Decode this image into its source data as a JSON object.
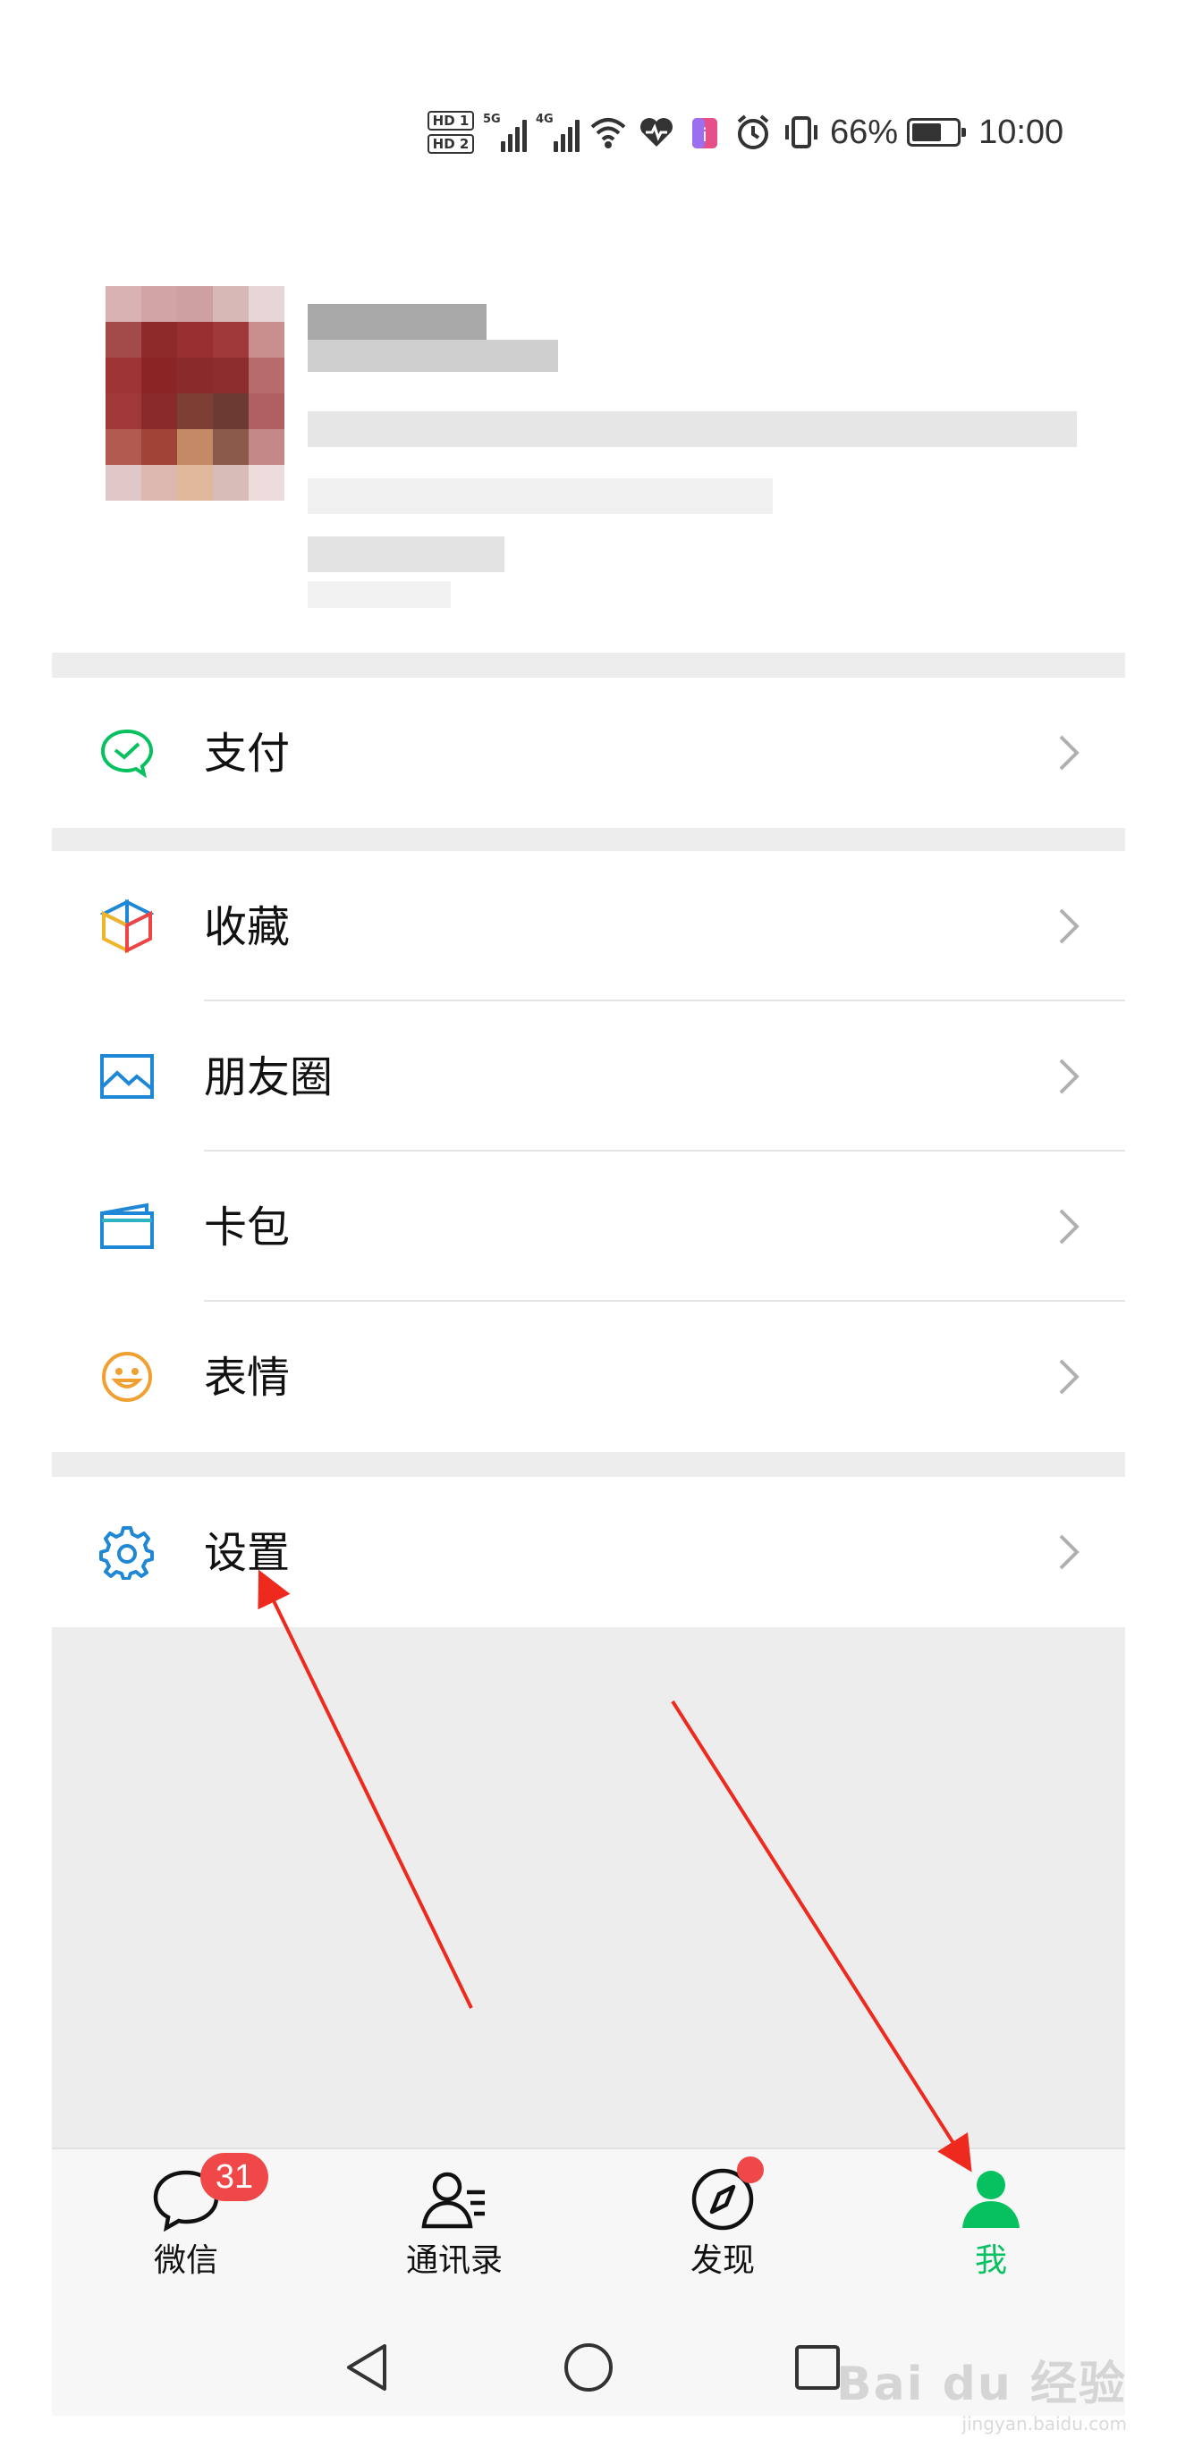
{
  "status_bar": {
    "hd1": "HD 1",
    "hd2": "HD 2",
    "signal1_tag": "5G",
    "signal2_tag": "4G",
    "battery_percent": "66%",
    "battery_level": 0.66,
    "time": "10:00",
    "icons": [
      "wifi-icon",
      "health-heart-icon",
      "app-notification-icon",
      "alarm-icon",
      "vibrate-icon",
      "battery-icon"
    ]
  },
  "profile": {
    "avatar": "pixelated-avatar",
    "name_blurred": true
  },
  "menu": {
    "pay": {
      "label": "支付",
      "icon": "wechat-pay-icon",
      "color": "#07c160"
    },
    "favorites": {
      "label": "收藏",
      "icon": "favorites-cube-icon"
    },
    "moments": {
      "label": "朋友圈",
      "icon": "moments-picture-icon",
      "color": "#1e88d6"
    },
    "cards": {
      "label": "卡包",
      "icon": "card-wallet-icon",
      "color": "#1e88d6"
    },
    "stickers": {
      "label": "表情",
      "icon": "sticker-smile-icon",
      "color": "#f0a030"
    },
    "settings": {
      "label": "设置",
      "icon": "settings-gear-icon",
      "color": "#1e88d6"
    }
  },
  "tabbar": {
    "tabs": [
      {
        "label": "微信",
        "icon": "chat-bubble-icon",
        "badge": "31"
      },
      {
        "label": "通讯录",
        "icon": "contacts-icon"
      },
      {
        "label": "发现",
        "icon": "compass-icon",
        "dot": true
      },
      {
        "label": "我",
        "icon": "person-icon",
        "active": true
      }
    ],
    "active_color": "#07c160"
  },
  "navbar": {
    "buttons": [
      "back-triangle-icon",
      "home-circle-icon",
      "recents-square-icon"
    ]
  },
  "watermark": {
    "main": "Bai du 经验",
    "sub": "jingyan.baidu.com"
  },
  "annotation": {
    "color": "#ee2a1f"
  }
}
